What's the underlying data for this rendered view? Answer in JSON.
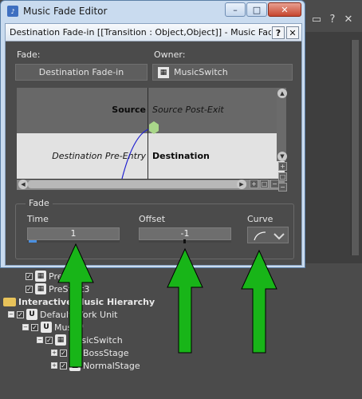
{
  "outer_window": {
    "title": "Music Fade Editor",
    "min_glyph": "–",
    "max_glyph": "□",
    "close_glyph": "✕"
  },
  "inner_window": {
    "title": "Destination Fade-in [[Transition : Object,Object]] - Music Fade Editor",
    "help_glyph": "?",
    "close_glyph": "✕"
  },
  "fade_label": "Fade:",
  "owner_label": "Owner:",
  "fade_value": "Destination Fade-in",
  "owner_value": "MusicSwitch",
  "graph": {
    "source_label": "Source",
    "source_post_exit": "Source Post-Exit",
    "destination_pre_entry": "Destination Pre-Entry",
    "destination_label": "Destination"
  },
  "fade_group": {
    "title": "Fade",
    "time_label": "Time",
    "time_value": "1",
    "offset_label": "Offset",
    "offset_value": "-1",
    "curve_label": "Curve"
  },
  "background": {
    "tree_items": [
      "PreStart2",
      "PreStart3",
      "Interactive Music Hierarchy",
      "Default Work Unit",
      "Music*",
      "MusicSwitch",
      "BossStage",
      "NormalStage"
    ]
  },
  "colors": {
    "accent_green": "#18b518",
    "graph_dark": "#686868",
    "graph_light": "#e2e2e2",
    "curve_blue": "#1f1fd0",
    "marker_green": "#a9d68a"
  },
  "icons": {
    "app": "music-fade-editor-icon",
    "curve": "fade-curve-icon",
    "owner": "music-switch-icon"
  }
}
